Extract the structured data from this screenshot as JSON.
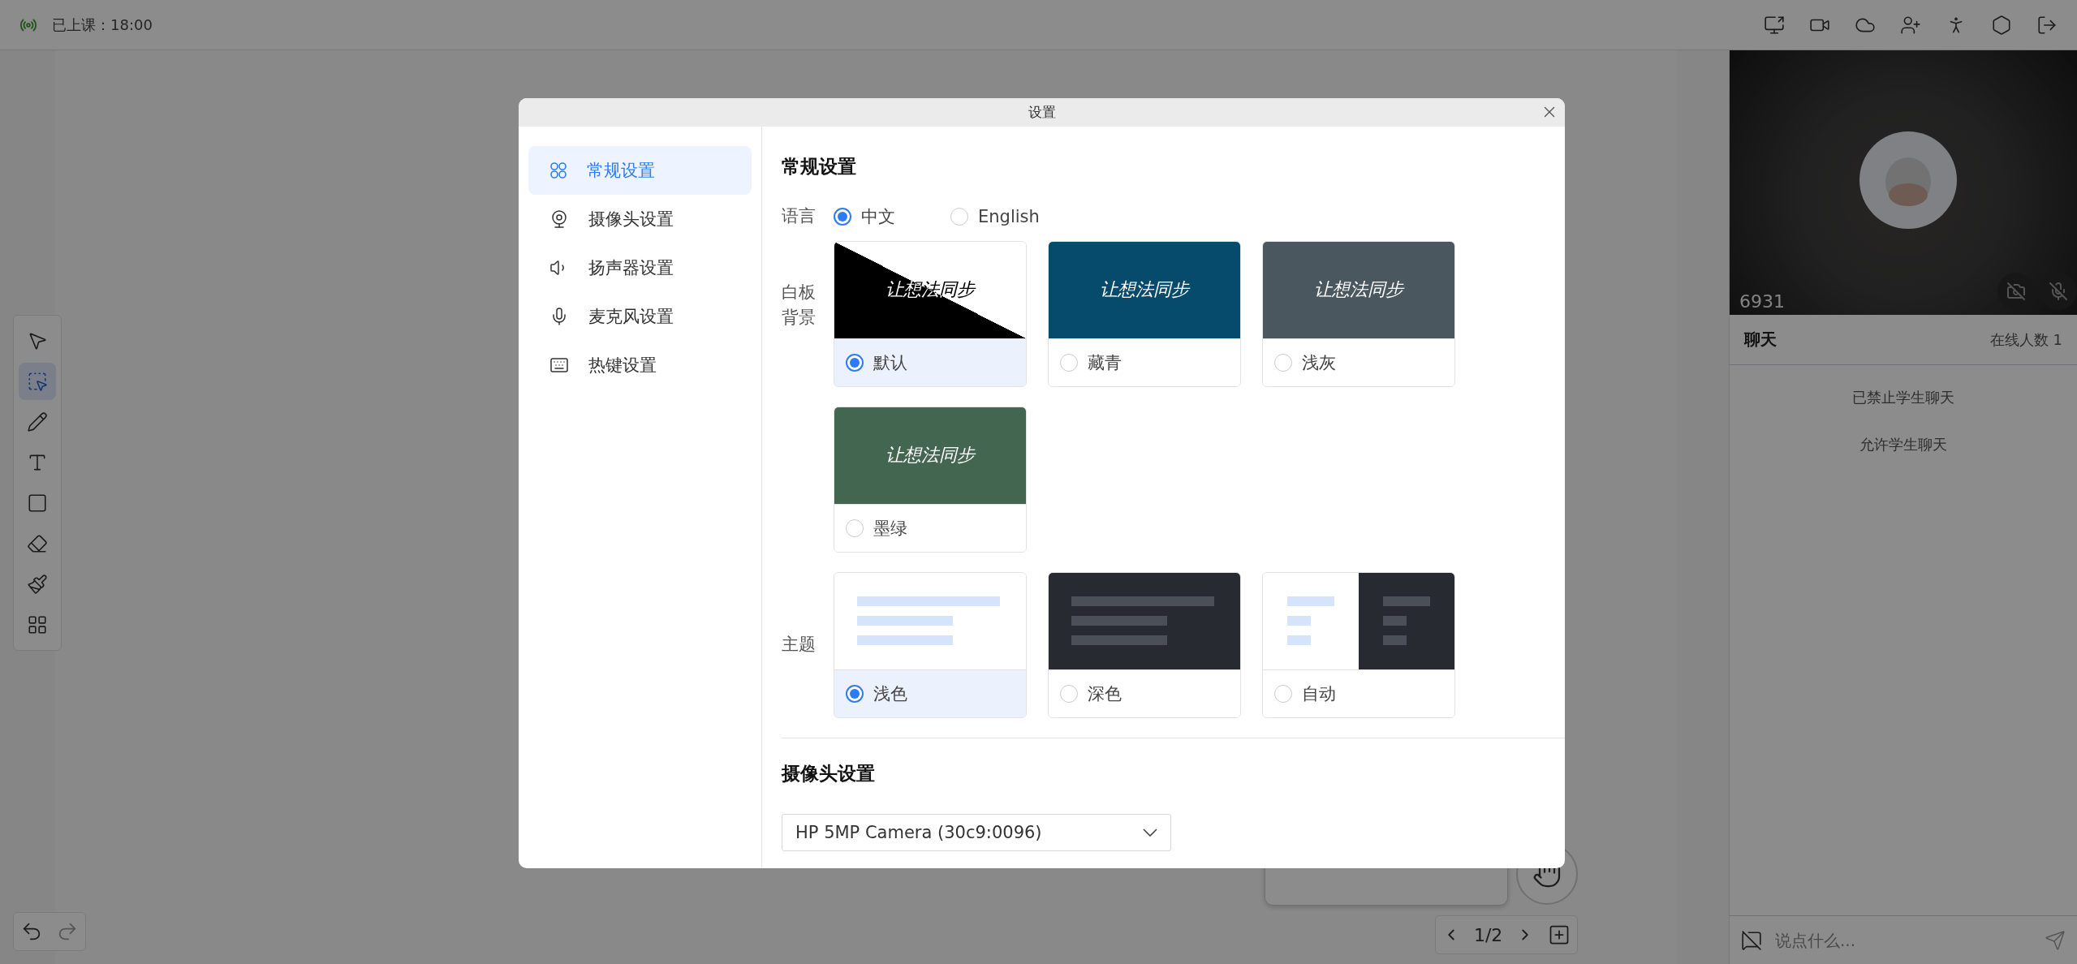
{
  "status": {
    "text": "已上课：18:00"
  },
  "tools": [
    {
      "kind": "pointer",
      "selected": false
    },
    {
      "kind": "select",
      "selected": true
    },
    {
      "kind": "pen",
      "selected": false
    },
    {
      "kind": "text",
      "selected": false
    },
    {
      "kind": "shape",
      "selected": false
    },
    {
      "kind": "eraser",
      "selected": false
    },
    {
      "kind": "clear",
      "selected": false
    },
    {
      "kind": "more",
      "selected": false
    }
  ],
  "pager": {
    "text": "1/2"
  },
  "video": {
    "name": "6931",
    "camera_on": false,
    "mic_on": false
  },
  "chat": {
    "title": "聊天",
    "online": "在线人数 1",
    "messages": [
      "已禁止学生聊天",
      "允许学生聊天"
    ],
    "input": {
      "placeholder": "说点什么..."
    }
  },
  "dialog": {
    "title": "设置",
    "nav": [
      {
        "label": "常规设置",
        "kind": "general",
        "selected": true
      },
      {
        "label": "摄像头设置",
        "kind": "camera",
        "selected": false
      },
      {
        "label": "扬声器设置",
        "kind": "speaker",
        "selected": false
      },
      {
        "label": "麦克风设置",
        "kind": "mic",
        "selected": false
      },
      {
        "label": "热键设置",
        "kind": "hotkey",
        "selected": false
      }
    ],
    "general": {
      "heading": "常规设置",
      "language": {
        "label": "语言",
        "options": [
          {
            "label": "中文",
            "selected": true
          },
          {
            "label": "English",
            "selected": false
          }
        ]
      },
      "background": {
        "label": "白板背景",
        "options": [
          {
            "label": "默认",
            "kind": "split",
            "preview_text": "让想法同步",
            "color": "#000000",
            "selected": true
          },
          {
            "label": "藏青",
            "kind": "solid",
            "preview_text": "让想法同步",
            "color": "#064b6b",
            "selected": false
          },
          {
            "label": "浅灰",
            "kind": "solid",
            "preview_text": "让想法同步",
            "color": "#4a575e",
            "selected": false
          },
          {
            "label": "墨绿",
            "kind": "solid",
            "preview_text": "让想法同步",
            "color": "#436650",
            "selected": false
          }
        ]
      },
      "theme": {
        "label": "主题",
        "options": [
          {
            "label": "浅色",
            "kind": "light",
            "selected": true
          },
          {
            "label": "深色",
            "kind": "dark",
            "selected": false
          },
          {
            "label": "自动",
            "kind": "auto",
            "selected": false
          }
        ]
      }
    },
    "camera": {
      "heading": "摄像头设置",
      "device": "HP 5MP Camera (30c9:0096)"
    }
  }
}
